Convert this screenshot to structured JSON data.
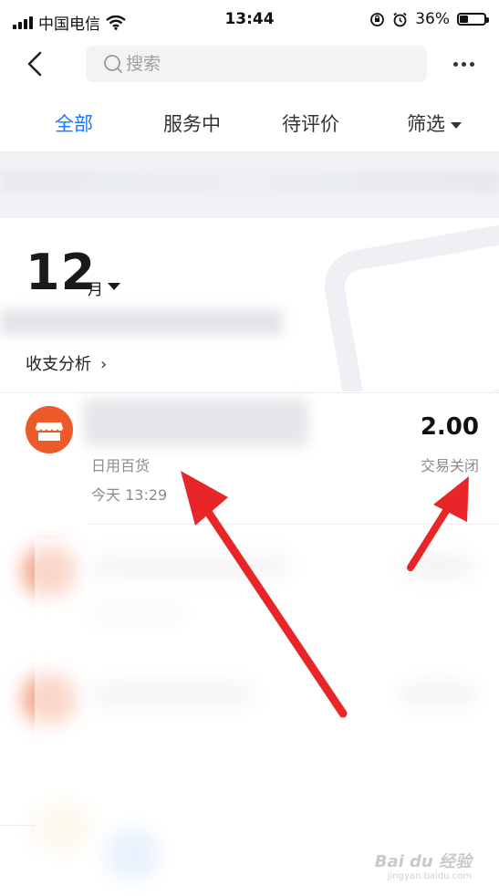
{
  "status_bar": {
    "carrier": "中国电信",
    "time": "13:44",
    "battery_text": "36%",
    "battery_level": 0.36
  },
  "nav": {
    "search_placeholder": "搜索"
  },
  "tabs": [
    {
      "label": "全部",
      "active": true
    },
    {
      "label": "服务中",
      "active": false
    },
    {
      "label": "待评价",
      "active": false
    },
    {
      "label": "筛选",
      "active": false
    }
  ],
  "month": {
    "number": "12",
    "unit": "月"
  },
  "analysis": {
    "label": "收支分析",
    "chevron": "›"
  },
  "transaction": {
    "amount": "2.00",
    "category": "日用百货",
    "status": "交易关闭",
    "time": "今天  13:29",
    "icon": "store-icon"
  },
  "watermark": {
    "brand": "Bai du 经验",
    "url": "jingyan.baidu.com"
  },
  "colors": {
    "accent": "#1677ff",
    "store_icon": "#ec5a2a",
    "arrow": "#e8262a"
  }
}
